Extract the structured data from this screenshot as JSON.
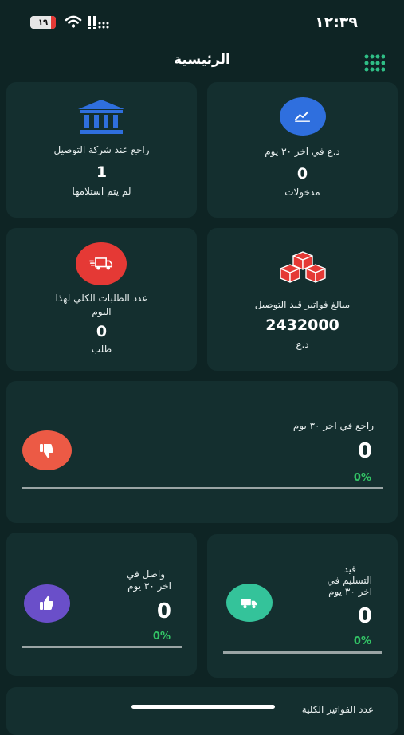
{
  "status": {
    "time": "١٢:٣٩",
    "battery": "١٩"
  },
  "header": {
    "title": "الرئيسية",
    "menu_icon": "grid-dots-icon"
  },
  "cards": {
    "income": {
      "label": "د.ع في اخر ٣٠ يوم",
      "value": "0",
      "sub": "مدخولات",
      "icon": "chart-line-icon",
      "color": "#2f6fde"
    },
    "returned_company": {
      "label": "راجع عند شركة التوصيل",
      "value": "1",
      "sub": "لم يتم استلامها",
      "icon": "bank-icon",
      "color": "#2f6fde"
    },
    "invoices_delivery": {
      "label": "مبالغ فواتير قيد التوصيل",
      "value": "2432000",
      "sub": "د.ع",
      "icon": "boxes-icon",
      "color": "#e53935"
    },
    "orders_today": {
      "label_line1": "عدد الطلبات الكلي لهذا",
      "label_line2": "اليوم",
      "value": "0",
      "sub": "طلب",
      "icon": "delivery-truck-icon",
      "color": "#e53935"
    },
    "returned_30": {
      "label": "راجع في اخر ٣٠ يوم",
      "value": "0",
      "percent": "0%",
      "percent_value": 0,
      "icon": "thumbs-down-icon",
      "color": "#ec5a45"
    },
    "under_delivery": {
      "label_line1": "قيد",
      "label_line2": "التسليم في",
      "label_line3": "اخر ٣٠ يوم",
      "value": "0",
      "percent": "0%",
      "percent_value": 0,
      "icon": "truck-icon",
      "color": "#34c39a"
    },
    "arrived": {
      "label_line1": "واصل في",
      "label_line2": "اخر ٣٠ يوم",
      "value": "0",
      "percent": "0%",
      "percent_value": 0,
      "icon": "thumbs-up-icon",
      "color": "#6a4fc9"
    },
    "total_invoices": {
      "label": "عدد الفواتير الكلية"
    }
  }
}
